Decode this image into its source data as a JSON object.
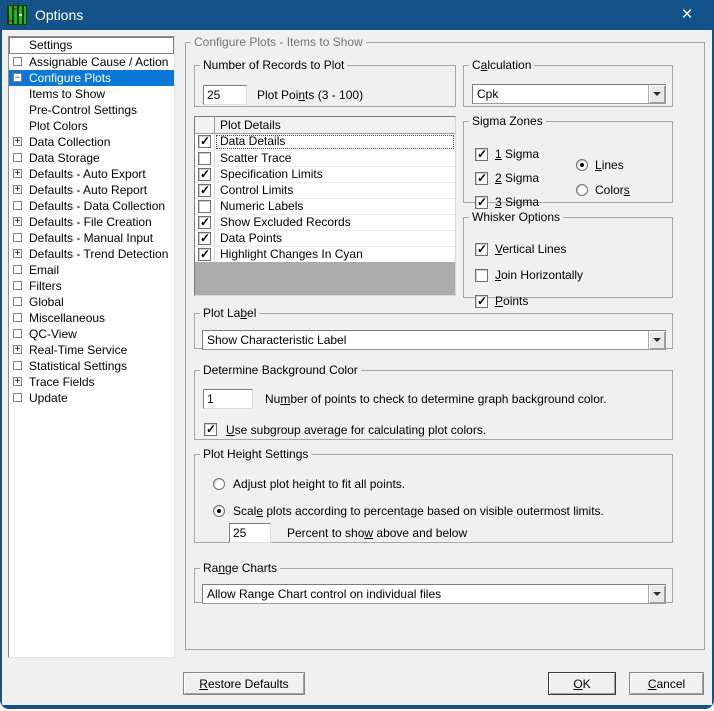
{
  "window": {
    "title": "Options",
    "close_glyph": "×"
  },
  "colors": {
    "titlebar": "#14528a",
    "selection": "#0a78d4",
    "dialog_bg": "#f0f0f0",
    "list_filler": "#ababab",
    "icon_green": "#22b422",
    "icon_red": "#cc2222"
  },
  "sidebar": {
    "header": "Settings",
    "items": [
      {
        "label": "Assignable Cause / Action",
        "glyph": "box",
        "selected": false
      },
      {
        "label": "Configure Plots",
        "glyph": "minus",
        "selected": true
      },
      {
        "label": "Items to Show",
        "glyph": "none",
        "selected": false
      },
      {
        "label": "Pre-Control Settings",
        "glyph": "none",
        "selected": false
      },
      {
        "label": "Plot Colors",
        "glyph": "none",
        "selected": false
      },
      {
        "label": "Data Collection",
        "glyph": "plus",
        "selected": false
      },
      {
        "label": "Data Storage",
        "glyph": "box",
        "selected": false
      },
      {
        "label": "Defaults - Auto Export",
        "glyph": "plus",
        "selected": false
      },
      {
        "label": "Defaults - Auto Report",
        "glyph": "plus",
        "selected": false
      },
      {
        "label": "Defaults - Data Collection",
        "glyph": "box",
        "selected": false
      },
      {
        "label": "Defaults - File Creation",
        "glyph": "plus",
        "selected": false
      },
      {
        "label": "Defaults - Manual Input",
        "glyph": "box",
        "selected": false
      },
      {
        "label": "Defaults - Trend Detection",
        "glyph": "plus",
        "selected": false
      },
      {
        "label": "Email",
        "glyph": "box",
        "selected": false
      },
      {
        "label": "Filters",
        "glyph": "box",
        "selected": false
      },
      {
        "label": "Global",
        "glyph": "box",
        "selected": false
      },
      {
        "label": "Miscellaneous",
        "glyph": "box",
        "selected": false
      },
      {
        "label": "QC-View",
        "glyph": "box",
        "selected": false
      },
      {
        "label": "Real-Time Service",
        "glyph": "plus",
        "selected": false
      },
      {
        "label": "Statistical Settings",
        "glyph": "box",
        "selected": false
      },
      {
        "label": "Trace Fields",
        "glyph": "plus",
        "selected": false
      },
      {
        "label": "Update",
        "glyph": "box",
        "selected": false
      }
    ]
  },
  "main": {
    "group_title": "Configure Plots - Items to Show",
    "records": {
      "title": "Number of Records to Plot",
      "value": "25",
      "label": "Plot Poi&nts (3 - 100)"
    },
    "calculation": {
      "title": "C&alculation",
      "value": "Cpk"
    },
    "plot_details": {
      "header": "Plot Details",
      "rows": [
        {
          "label": "Data Details",
          "checked": true,
          "focused": true
        },
        {
          "label": "Scatter Trace",
          "checked": false,
          "focused": false
        },
        {
          "label": "Specification Limits",
          "checked": true,
          "focused": false
        },
        {
          "label": "Control Limits",
          "checked": true,
          "focused": false
        },
        {
          "label": "Numeric Labels",
          "checked": false,
          "focused": false
        },
        {
          "label": "Show Excluded Records",
          "checked": true,
          "focused": false
        },
        {
          "label": "Data Points",
          "checked": true,
          "focused": false
        },
        {
          "label": "Highlight Changes In Cyan",
          "checked": true,
          "focused": false
        }
      ]
    },
    "sigma_zones": {
      "title": "Sigma Zones",
      "checkboxes": [
        {
          "label": "&1 Sigma",
          "checked": true
        },
        {
          "label": "&2 Sigma",
          "checked": true
        },
        {
          "label": "&3 Sigma",
          "checked": true
        }
      ],
      "radios": [
        {
          "label": "&Lines",
          "selected": true
        },
        {
          "label": "Color&s",
          "selected": false
        }
      ]
    },
    "whisker": {
      "title": "Whisker Options",
      "checkboxes": [
        {
          "label": "&Vertical Lines",
          "checked": true
        },
        {
          "label": "&Join Horizontally",
          "checked": false
        },
        {
          "label": "&Points",
          "checked": true
        }
      ]
    },
    "plot_label": {
      "title": "Plot La&bel",
      "value": "Show Characteristic Label"
    },
    "background_color": {
      "title": "Determine Background Color",
      "points_value": "1",
      "points_label": "Nu&mber of points to check to determine graph background color.",
      "subgroup_label": "&Use subgroup average for calculating plot colors.",
      "subgroup_checked": true
    },
    "plot_height": {
      "title": "Plot Height Settings",
      "radios": [
        {
          "label": "Ad&just plot height to fit all points.",
          "selected": false
        },
        {
          "label": "Scal&e plots according to percentage based on visible outermost limits.",
          "selected": true
        }
      ],
      "percent_value": "25",
      "percent_label": "Percent to sho&w above and below"
    },
    "range_charts": {
      "title": "Ra&nge Charts",
      "value": "Allow Range Chart control on individual files"
    }
  },
  "buttons": {
    "restore": "&Restore Defaults",
    "ok": "&OK",
    "cancel": "&Cancel"
  }
}
